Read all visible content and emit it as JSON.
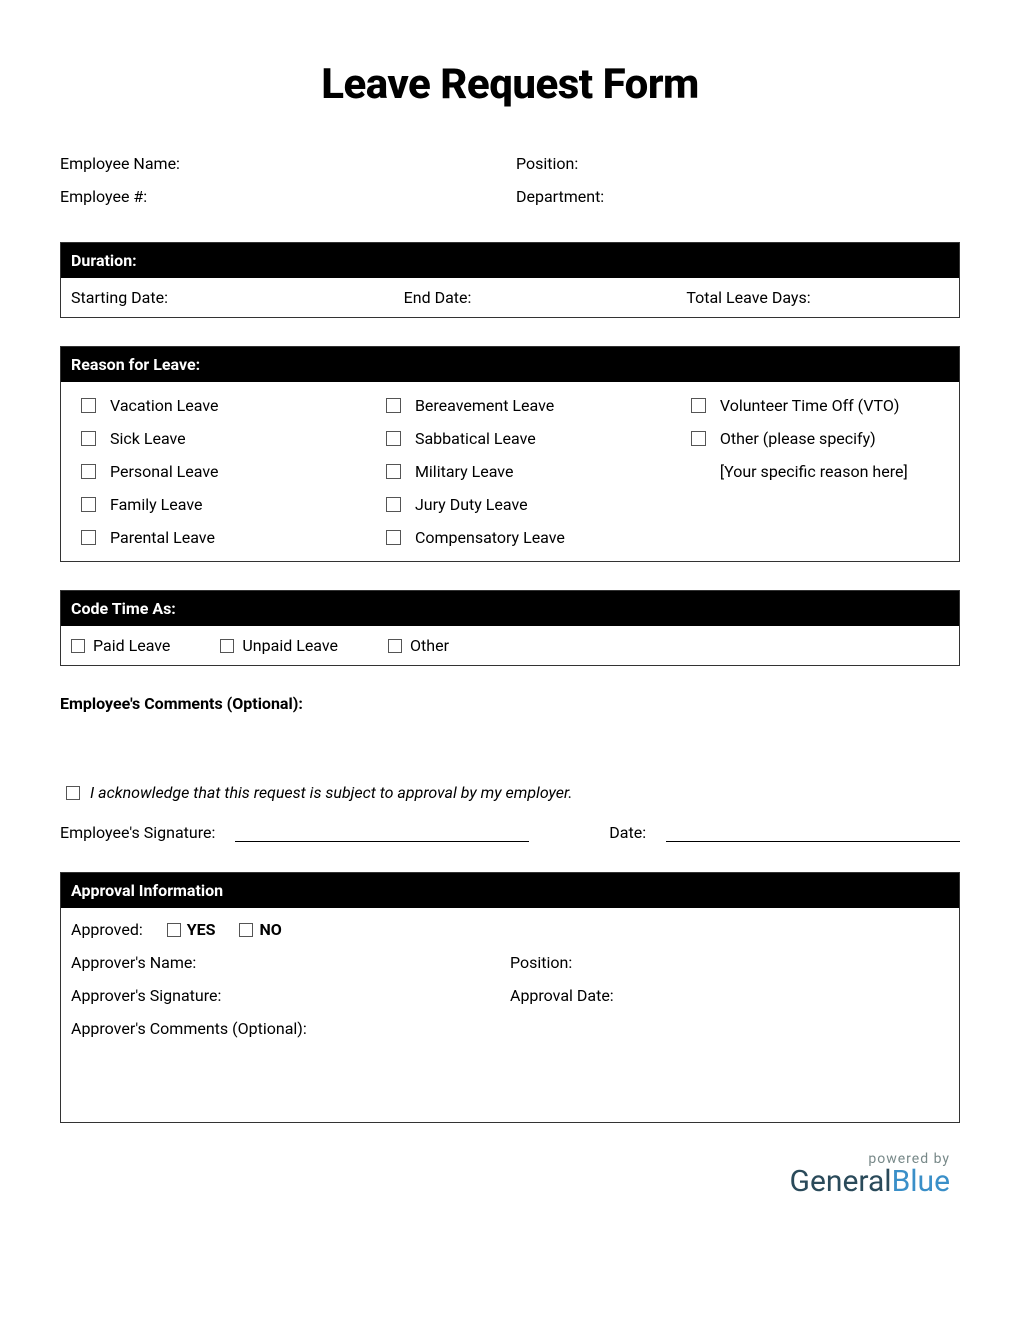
{
  "title": "Leave Request Form",
  "employee": {
    "name_label": "Employee Name:",
    "position_label": "Position:",
    "number_label": "Employee #:",
    "department_label": "Department:"
  },
  "duration": {
    "header": "Duration:",
    "start_label": "Starting Date:",
    "end_label": "End Date:",
    "total_label": "Total Leave Days:"
  },
  "reason": {
    "header": "Reason for Leave:",
    "col1": [
      "Vacation Leave",
      "Sick Leave",
      "Personal Leave",
      "Family Leave",
      "Parental Leave"
    ],
    "col2": [
      "Bereavement Leave",
      "Sabbatical Leave",
      "Military Leave",
      "Jury Duty Leave",
      "Compensatory Leave"
    ],
    "col3_opt1": "Volunteer Time Off (VTO)",
    "col3_opt2": "Other (please specify)",
    "col3_placeholder": "[Your specific reason here]"
  },
  "code_time": {
    "header": "Code Time As:",
    "options": [
      "Paid Leave",
      "Unpaid Leave",
      "Other"
    ]
  },
  "comments_label": "Employee's Comments (Optional):",
  "acknowledge": "I acknowledge that this request is subject to approval by my employer.",
  "sig": {
    "emp_label": "Employee's Signature:",
    "date_label": "Date:"
  },
  "approval": {
    "header": "Approval Information",
    "approved_label": "Approved:",
    "yes": "YES",
    "no": "NO",
    "name_label": "Approver's Name:",
    "position_label": "Position:",
    "signature_label": "Approver's Signature:",
    "date_label": "Approval Date:",
    "comments_label": "Approver's Comments (Optional):"
  },
  "footer": {
    "powered": "powered by",
    "logo1": "General",
    "logo2": "Blue"
  }
}
